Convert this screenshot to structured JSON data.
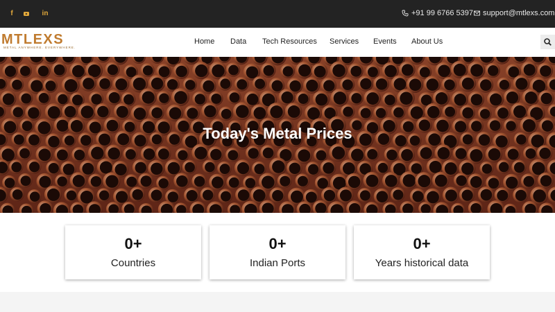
{
  "topbar": {
    "social": [
      {
        "name": "facebook",
        "glyph": "f"
      },
      {
        "name": "youtube",
        "glyph": "▶"
      },
      {
        "name": "linkedin",
        "glyph": "in"
      }
    ],
    "phone": "+91 99 6766 5397",
    "email": "support@mtlexs.com",
    "icon_color": "#e2a93b"
  },
  "logo": {
    "word": "MTLEXS",
    "tagline": "METAL ANYWHERE. EVERYWHERE.",
    "color": "#c07b2f"
  },
  "nav": {
    "items": [
      "Home",
      "Data",
      "Tech Resources",
      "Services",
      "Events",
      "About Us"
    ]
  },
  "hero": {
    "title": "Today's Metal Prices"
  },
  "stats": [
    {
      "value": "0+",
      "label": "Countries"
    },
    {
      "value": "0+",
      "label": "Indian Ports"
    },
    {
      "value": "0+",
      "label": "Years historical data"
    }
  ]
}
